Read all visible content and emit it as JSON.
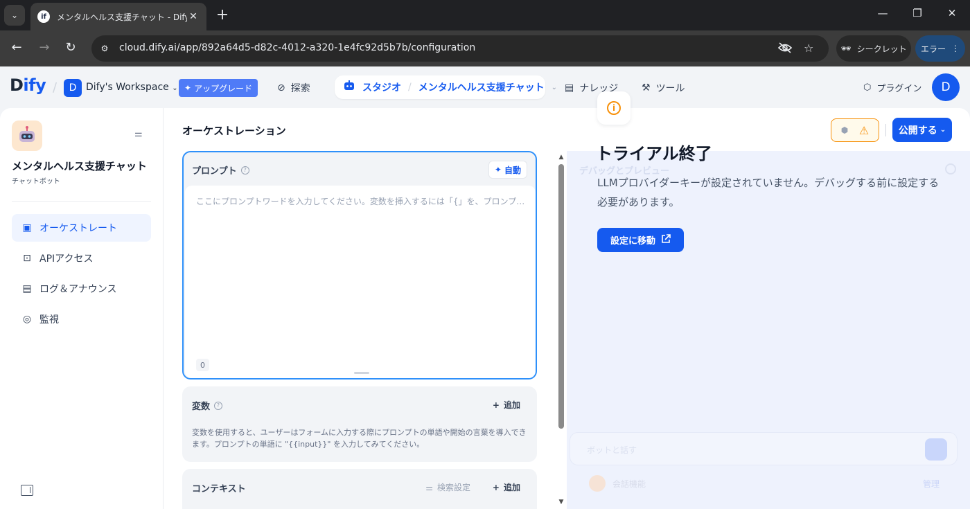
{
  "browser": {
    "tab_title": "メンタルヘルス支援チャット - Dify",
    "favicon_text": "if",
    "url": "cloud.dify.ai/app/892a64d5-d82c-4012-a320-1e4fc92d5b7b/configuration",
    "incognito_label": "シークレット",
    "error_label": "エラー"
  },
  "header": {
    "logo_prefix": "D",
    "logo_accent": "ify",
    "workspace_initial": "D",
    "workspace_name": "Dify's Workspace",
    "upgrade_label": "アップグレード",
    "nav": {
      "explore": "探索",
      "studio": "スタジオ",
      "current_app": "メンタルヘルス支援チャット",
      "knowledge": "ナレッジ",
      "tools": "ツール"
    },
    "plugin_label": "プラグイン",
    "user_initial": "D"
  },
  "sidebar": {
    "app_name": "メンタルヘルス支援チャット",
    "app_type": "チャットボット",
    "items": [
      {
        "label": "オーケストレート"
      },
      {
        "label": "APIアクセス"
      },
      {
        "label": "ログ＆アナウンス"
      },
      {
        "label": "監視"
      }
    ]
  },
  "main": {
    "title": "オーケストレーション",
    "publish_label": "公開する",
    "prompt": {
      "title": "プロンプト",
      "auto_label": "自動",
      "placeholder": "ここにプロンプトワードを入力してください。変数を挿入するには「{」を、プロンプトコンテンツブロックを挿入するには「/」を入力します。",
      "char_count": "0"
    },
    "variables": {
      "title": "変数",
      "add_label": "追加",
      "description": "変数を使用すると、ユーザーはフォームに入力する際にプロンプトの単語や開始の言葉を導入できます。プロンプトの単語に \"{{input}}\" を入力してみてください。"
    },
    "context": {
      "title": "コンテキスト",
      "search_settings": "検索設定",
      "add_label": "追加"
    }
  },
  "preview": {
    "faint_title": "デバッグとプレビュー",
    "trial_title": "トライアル終了",
    "trial_desc": "LLMプロバイダーキーが設定されていません。デバッグする前に設定する必要があります。",
    "goto_label": "設定に移動",
    "input_placeholder": "ボットと話す",
    "feature_label": "会話機能",
    "feature_manage": "管理"
  },
  "colors": {
    "accent": "#155aef",
    "warning": "#f79009",
    "prompt_border": "#2e90fa"
  }
}
